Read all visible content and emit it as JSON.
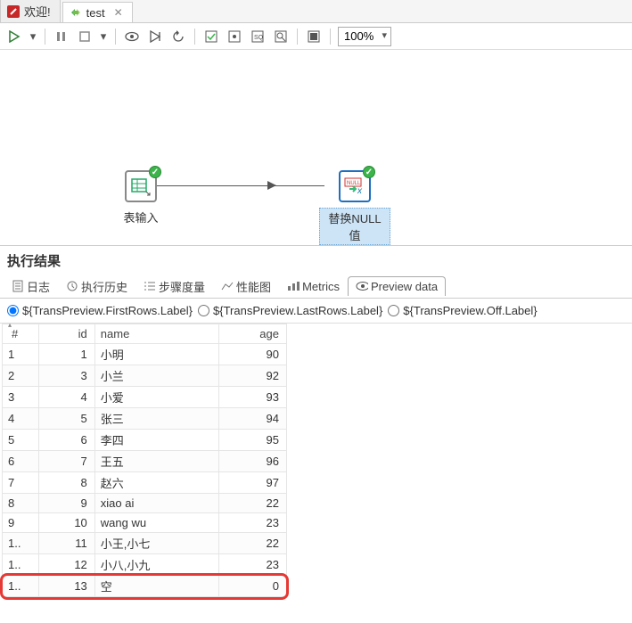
{
  "tabs": [
    {
      "label": "欢迎!",
      "icon": "spoon-icon"
    },
    {
      "label": "test",
      "icon": "transform-icon",
      "closable": true
    }
  ],
  "toolbar": {
    "zoom": "100%"
  },
  "canvas": {
    "node1_label": "表输入",
    "node2_label": "替换NULL值"
  },
  "results_header": "执行结果",
  "sub_tabs": {
    "log": "日志",
    "history": "执行历史",
    "metrics_cn": "步骤度量",
    "perf": "性能图",
    "metrics_en": "Metrics",
    "preview": "Preview data"
  },
  "preview_radios": {
    "first": "${TransPreview.FirstRows.Label}",
    "last": "${TransPreview.LastRows.Label}",
    "off": "${TransPreview.Off.Label}"
  },
  "columns": {
    "rownum": "#",
    "id": "id",
    "name": "name",
    "age": "age"
  },
  "rows": [
    {
      "n": "1",
      "id": "1",
      "name": "小明",
      "age": "90"
    },
    {
      "n": "2",
      "id": "3",
      "name": "小兰",
      "age": "92"
    },
    {
      "n": "3",
      "id": "4",
      "name": "小爱",
      "age": "93"
    },
    {
      "n": "4",
      "id": "5",
      "name": "张三",
      "age": "94"
    },
    {
      "n": "5",
      "id": "6",
      "name": "李四",
      "age": "95"
    },
    {
      "n": "6",
      "id": "7",
      "name": "王五",
      "age": "96"
    },
    {
      "n": "7",
      "id": "8",
      "name": "赵六",
      "age": "97"
    },
    {
      "n": "8",
      "id": "9",
      "name": "xiao ai",
      "age": "22"
    },
    {
      "n": "9",
      "id": "10",
      "name": "wang wu",
      "age": "23"
    },
    {
      "n": "1..",
      "id": "11",
      "name": "小王,小七",
      "age": "22"
    },
    {
      "n": "1..",
      "id": "12",
      "name": "小八,小九",
      "age": "23"
    },
    {
      "n": "1..",
      "id": "13",
      "name": "空",
      "age": "0"
    }
  ]
}
